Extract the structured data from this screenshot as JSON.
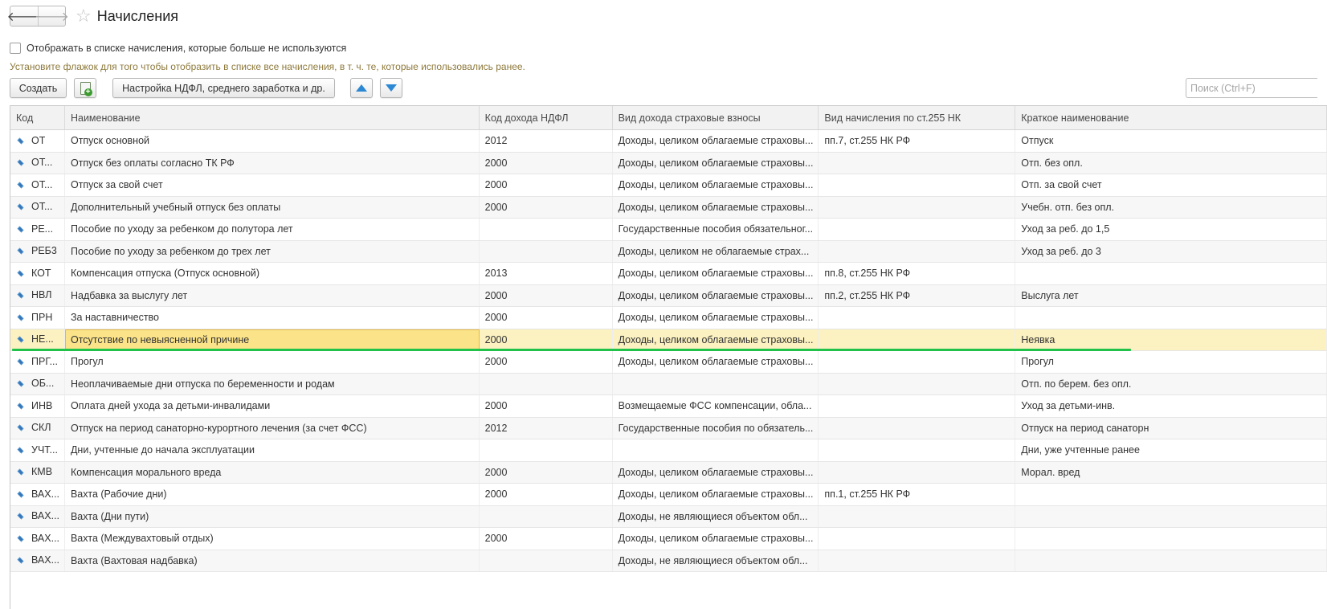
{
  "header": {
    "title": "Начисления",
    "back_glyph": "🡐",
    "forward_glyph": "🡒",
    "star_glyph": "☆"
  },
  "filter": {
    "checkbox_label": "Отображать в списке начисления, которые больше не используются",
    "checked": false,
    "hint": "Установите флажок для того чтобы отобразить в списке все начисления, в т. ч. те, которые использовались ранее."
  },
  "toolbar": {
    "create_label": "Создать",
    "settings_label": "Настройка НДФЛ, среднего заработка и др.",
    "search_placeholder": "Поиск (Ctrl+F)"
  },
  "table": {
    "columns": [
      "Код",
      "Наименование",
      "Код дохода НДФЛ",
      "Вид дохода страховые взносы",
      "Вид начисления по ст.255 НК",
      "Краткое наименование"
    ],
    "selected_row": 9,
    "rows": [
      {
        "code": "ОТ",
        "name": "Отпуск основной",
        "ndfl": "2012",
        "ins": "Доходы, целиком облагаемые страховы...",
        "art255": "пп.7, ст.255 НК РФ",
        "short": "Отпуск"
      },
      {
        "code": "ОТ...",
        "name": "Отпуск без оплаты согласно ТК РФ",
        "ndfl": "2000",
        "ins": "Доходы, целиком облагаемые страховы...",
        "art255": "",
        "short": "Отп. без опл."
      },
      {
        "code": "ОТ...",
        "name": "Отпуск за свой счет",
        "ndfl": "2000",
        "ins": "Доходы, целиком облагаемые страховы...",
        "art255": "",
        "short": "Отп. за свой счет"
      },
      {
        "code": "ОТ...",
        "name": "Дополнительный учебный отпуск без оплаты",
        "ndfl": "2000",
        "ins": "Доходы, целиком облагаемые страховы...",
        "art255": "",
        "short": "Учебн. отп. без опл."
      },
      {
        "code": "РЕ...",
        "name": "Пособие по уходу за ребенком до полутора лет",
        "ndfl": "",
        "ins": "Государственные пособия обязательног...",
        "art255": "",
        "short": "Уход за реб. до 1,5"
      },
      {
        "code": "РЕБ3",
        "name": "Пособие по уходу за ребенком до трех лет",
        "ndfl": "",
        "ins": "Доходы, целиком не облагаемые страх...",
        "art255": "",
        "short": "Уход за реб. до 3"
      },
      {
        "code": "КОТ",
        "name": "Компенсация отпуска (Отпуск основной)",
        "ndfl": "2013",
        "ins": "Доходы, целиком облагаемые страховы...",
        "art255": "пп.8, ст.255 НК РФ",
        "short": ""
      },
      {
        "code": "НВЛ",
        "name": "Надбавка за выслугу лет",
        "ndfl": "2000",
        "ins": "Доходы, целиком облагаемые страховы...",
        "art255": "пп.2, ст.255 НК РФ",
        "short": "Выслуга лет"
      },
      {
        "code": "ПРН",
        "name": "За наставничество",
        "ndfl": "2000",
        "ins": "Доходы, целиком облагаемые страховы...",
        "art255": "",
        "short": ""
      },
      {
        "code": "НЕ...",
        "name": "Отсутствие по невыясненной причине",
        "ndfl": "2000",
        "ins": "Доходы, целиком облагаемые страховы...",
        "art255": "",
        "short": "Неявка"
      },
      {
        "code": "ПРГ...",
        "name": "Прогул",
        "ndfl": "2000",
        "ins": "Доходы, целиком облагаемые страховы...",
        "art255": "",
        "short": "Прогул"
      },
      {
        "code": "ОБ...",
        "name": "Неоплачиваемые дни отпуска по беременности и родам",
        "ndfl": "",
        "ins": "",
        "art255": "",
        "short": "Отп. по берем. без опл."
      },
      {
        "code": "ИНВ",
        "name": "Оплата дней ухода за детьми-инвалидами",
        "ndfl": "2000",
        "ins": "Возмещаемые ФСС компенсации, обла...",
        "art255": "",
        "short": "Уход за детьми-инв."
      },
      {
        "code": "СКЛ",
        "name": "Отпуск на период санаторно-курортного лечения (за счет ФСС)",
        "ndfl": "2012",
        "ins": "Государственные пособия по обязатель...",
        "art255": "",
        "short": "Отпуск на период санаторн"
      },
      {
        "code": "УЧТ...",
        "name": "Дни, учтенные до начала эксплуатации",
        "ndfl": "",
        "ins": "",
        "art255": "",
        "short": "Дни, уже учтенные ранее"
      },
      {
        "code": "КМВ",
        "name": "Компенсация морального вреда",
        "ndfl": "2000",
        "ins": "Доходы, целиком облагаемые страховы...",
        "art255": "",
        "short": "Морал. вред"
      },
      {
        "code": "ВАХ...",
        "name": "Вахта (Рабочие дни)",
        "ndfl": "2000",
        "ins": "Доходы, целиком облагаемые страховы...",
        "art255": "пп.1, ст.255 НК РФ",
        "short": ""
      },
      {
        "code": "ВАХ...",
        "name": "Вахта (Дни пути)",
        "ndfl": "",
        "ins": "Доходы, не являющиеся объектом обл...",
        "art255": "",
        "short": ""
      },
      {
        "code": "ВАХ...",
        "name": "Вахта (Междувахтовый отдых)",
        "ndfl": "2000",
        "ins": "Доходы, целиком облагаемые страховы...",
        "art255": "",
        "short": ""
      },
      {
        "code": "ВАХ...",
        "name": "Вахта (Вахтовая надбавка)",
        "ndfl": "",
        "ins": "Доходы, не являющиеся объектом обл...",
        "art255": "",
        "short": ""
      }
    ]
  }
}
